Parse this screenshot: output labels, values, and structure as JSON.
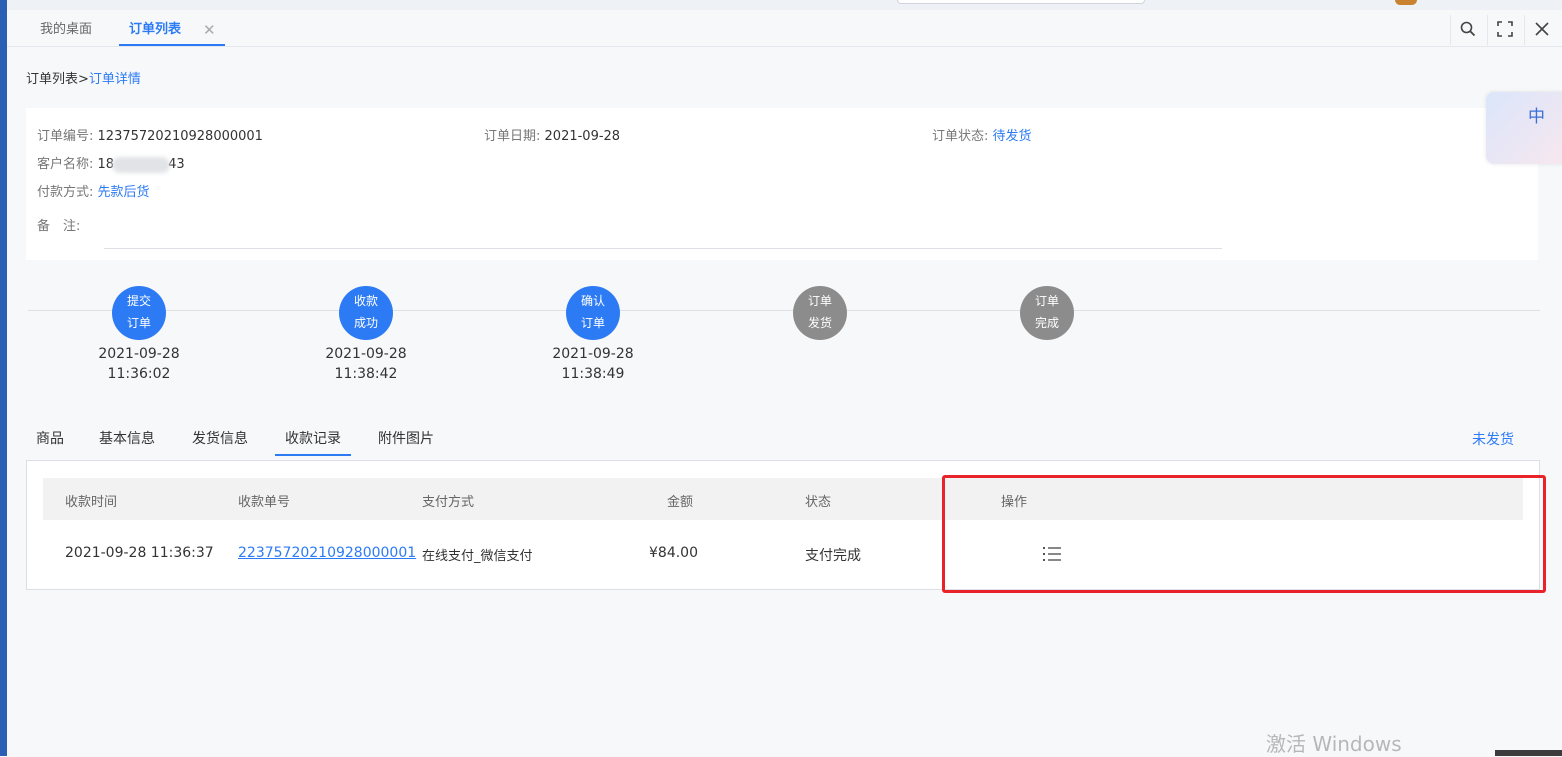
{
  "tabs": {
    "home": "我的桌面",
    "active": "订单列表",
    "close": "✕"
  },
  "icons": {
    "search": "search-icon",
    "fullscreen": "fullscreen-icon",
    "close": "close-icon",
    "list": "list-icon"
  },
  "breadcrumb": {
    "parent": "订单列表",
    "sep": ">",
    "current": "订单详情"
  },
  "order": {
    "no_label": "订单编号:",
    "no": "12375720210928000001",
    "date_label": "订单日期:",
    "date": "2021-09-28",
    "status_label": "订单状态:",
    "status": "待发货",
    "customer_label": "客户名称:",
    "customer_prefix": "18",
    "customer_suffix": "43",
    "payment_label": "付款方式:",
    "payment": "先款后货",
    "note_label": "备　注:"
  },
  "float_badge": "中",
  "steps": [
    {
      "l1": "提交",
      "l2": "订单",
      "date": "2021-09-28",
      "time": "11:36:02",
      "state": "done"
    },
    {
      "l1": "收款",
      "l2": "成功",
      "date": "2021-09-28",
      "time": "11:38:42",
      "state": "done"
    },
    {
      "l1": "确认",
      "l2": "订单",
      "date": "2021-09-28",
      "time": "11:38:49",
      "state": "done"
    },
    {
      "l1": "订单",
      "l2": "发货",
      "date": "",
      "time": "",
      "state": "pending"
    },
    {
      "l1": "订单",
      "l2": "完成",
      "date": "",
      "time": "",
      "state": "pending"
    }
  ],
  "content_tabs": [
    "商品",
    "基本信息",
    "发货信息",
    "收款记录",
    "附件图片"
  ],
  "active_content_tab": "收款记录",
  "ship_status": "未发货",
  "table": {
    "headers": [
      "收款时间",
      "收款单号",
      "支付方式",
      "金额",
      "状态",
      "操作"
    ],
    "rows": [
      {
        "time": "2021-09-28 11:36:37",
        "no": "22375720210928000001",
        "method": "在线支付_微信支付",
        "amount": "¥84.00",
        "status": "支付完成"
      }
    ]
  },
  "watermark": "激活 Windows",
  "colors": {
    "primary": "#2d7bf4",
    "pending": "#8c8c8c",
    "highlight": "#e8232a"
  }
}
